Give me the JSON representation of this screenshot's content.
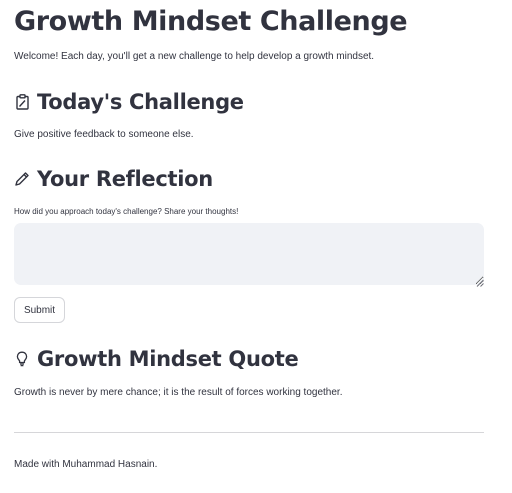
{
  "header": {
    "title": "Growth Mindset Challenge",
    "welcome_text": "Welcome! Each day, you'll get a new challenge to help develop a growth mindset."
  },
  "challenge": {
    "icon": "clipboard-icon",
    "heading": "Today's Challenge",
    "text": "Give positive feedback to someone else."
  },
  "reflection": {
    "icon": "pencil-icon",
    "heading": "Your Reflection",
    "prompt": "How did you approach today's challenge? Share your thoughts!",
    "input_value": "",
    "submit_label": "Submit"
  },
  "quote": {
    "icon": "lightbulb-icon",
    "heading": "Growth Mindset Quote",
    "text": "Growth is never by mere chance; it is the result of forces working together."
  },
  "footer": {
    "text": "Made with Muhammad Hasnain."
  },
  "colors": {
    "text": "#31333f",
    "input_background": "#f0f2f6",
    "button_border": "#d5d6da",
    "divider": "#d6d6d9"
  }
}
